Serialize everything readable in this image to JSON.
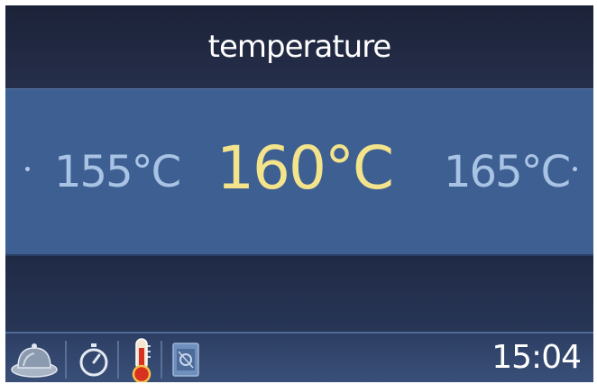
{
  "header": {
    "title": "temperature"
  },
  "temperature_selector": {
    "previous": "155°C",
    "current": "160°C",
    "next": "165°C"
  },
  "status_bar": {
    "icons": [
      "oven-dish-icon",
      "timer-icon",
      "thermometer-icon",
      "program-icon"
    ],
    "clock": "15:04"
  },
  "colors": {
    "background": "#232f4a",
    "selection_band": "#3d5f92",
    "current_value": "#f3e38a",
    "option_value": "#a9c3e4",
    "title_text": "#ffffff"
  }
}
